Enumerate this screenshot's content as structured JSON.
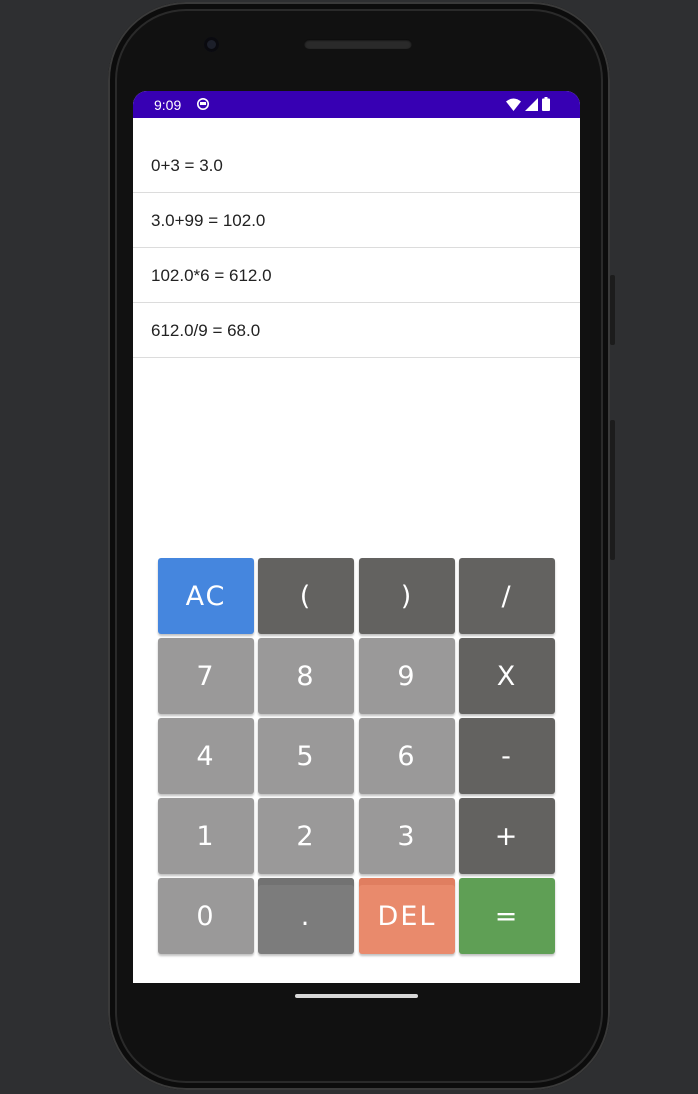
{
  "status_bar": {
    "time": "9:09",
    "app_icon": "android-debug-icon",
    "icons": [
      "wifi-icon",
      "signal-icon",
      "battery-icon"
    ],
    "color": "#3700b3"
  },
  "history": [
    "0+3 = 3.0",
    "3.0+99 = 102.0",
    "102.0*6 = 612.0",
    "612.0/9 = 68.0"
  ],
  "keypad": {
    "rows": [
      [
        "AC",
        "(",
        ")",
        "/"
      ],
      [
        "7",
        "8",
        "9",
        "X"
      ],
      [
        "4",
        "5",
        "6",
        "-"
      ],
      [
        "1",
        "2",
        "3",
        "+"
      ],
      [
        "0",
        ".",
        "DEL",
        "="
      ]
    ]
  },
  "colors": {
    "number_key": "#9a9999",
    "operator_key": "#636260",
    "clear_key": "#4586de",
    "delete_key": "#e98a6c",
    "equals_key": "#5f9f55"
  }
}
